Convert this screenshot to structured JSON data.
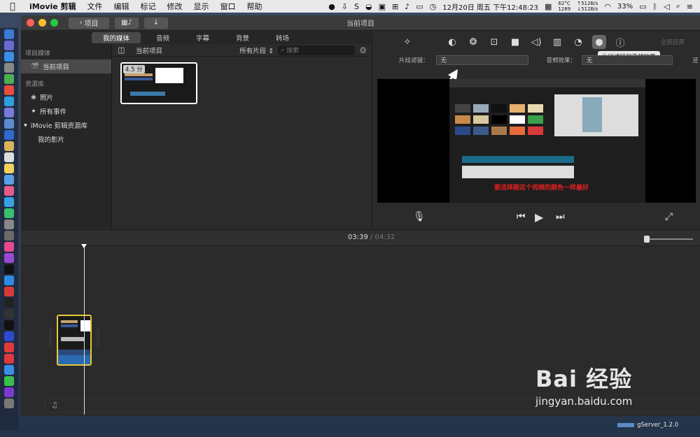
{
  "menubar": {
    "apple_icon": "apple-icon",
    "app_name": "iMovie 剪辑",
    "items": [
      "文件",
      "编辑",
      "标记",
      "修改",
      "显示",
      "窗口",
      "帮助"
    ],
    "status": {
      "datetime": "12月20日 周五 下午12:48:23",
      "temp": "62°C",
      "fan": "1289",
      "net_up": "↑512B/s",
      "net_down": "↓512B/s",
      "battery": "33%"
    }
  },
  "window": {
    "title": "当前项目",
    "back_label": "项目",
    "back_icon": "chevron-left-icon"
  },
  "media_tabs": {
    "items": [
      "我的媒体",
      "音频",
      "字幕",
      "背景",
      "转场"
    ],
    "active": "我的媒体"
  },
  "library": {
    "section_project": "项目媒体",
    "current_project": "当前项目",
    "section_library": "资源库",
    "photos": "照片",
    "all_events": "所有事件",
    "library_name": "iMovie 剪辑资源库",
    "my_movie": "我的影片"
  },
  "browser": {
    "title": "当前项目",
    "filter_label": "所有片段",
    "search_placeholder": "搜索",
    "clip_duration": "4.5 分"
  },
  "inspector": {
    "reset_all": "全部还原",
    "tooltip": "片段滤镜和音频效果",
    "clip_filter_label": "片段滤镜：",
    "clip_filter_value": "无",
    "audio_effect_label": "音频效果：",
    "audio_effect_value": "无",
    "cut_label": "还"
  },
  "viewer": {
    "caption": "要选择跟这个视频的颜色一样最好"
  },
  "timeline": {
    "current_time": "03:39",
    "separator": "/",
    "total_time": "04:32"
  },
  "overlay": {
    "baidu_logo": "Bai  经验",
    "baidu_url": "jingyan.baidu.com",
    "gserver": "gServer_1.2.0"
  },
  "colors": {
    "accent_yellow": "#e8c83a",
    "window_bg": "#2b2b2b",
    "caption_red": "#e02020"
  }
}
